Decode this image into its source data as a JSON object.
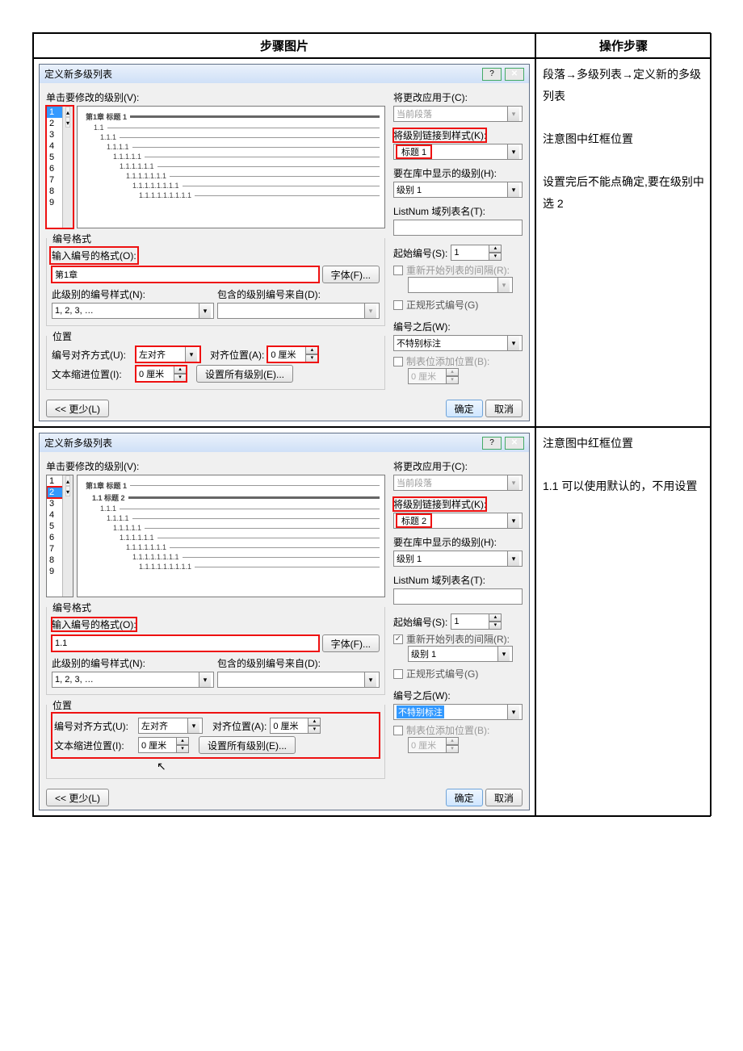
{
  "headers": {
    "left": "步骤图片",
    "right": "操作步骤"
  },
  "step1_text": [
    "段落→多级列表→定义新的多级列表",
    "",
    "注意图中红框位置",
    "",
    "设置完后不能点确定,要在级别中选 2"
  ],
  "step2_text": [
    "注意图中红框位置",
    "",
    "1.1 可以使用默认的，不用设置"
  ],
  "d1": {
    "title": "定义新多级列表",
    "click_label": "单击要修改的级别(V):",
    "levels": [
      "1",
      "2",
      "3",
      "4",
      "5",
      "6",
      "7",
      "8",
      "9"
    ],
    "sel_level": "1",
    "preview_top": "第1章 标题 1",
    "preview_items": [
      "1.1",
      "1.1.1",
      "1.1.1.1",
      "1.1.1.1.1",
      "1.1.1.1.1.1",
      "1.1.1.1.1.1.1",
      "1.1.1.1.1.1.1.1",
      "1.1.1.1.1.1.1.1.1"
    ],
    "numfmt_group": "编号格式",
    "numfmt_label": "输入编号的格式(O):",
    "numfmt_value": "第1章",
    "font_btn": "字体(F)...",
    "numstyle_label": "此级别的编号样式(N):",
    "numstyle_value": "1, 2, 3, …",
    "include_label": "包含的级别编号来自(D):",
    "include_value": "",
    "pos_group": "位置",
    "align_label": "编号对齐方式(U):",
    "align_value": "左对齐",
    "alignpos_label": "对齐位置(A):",
    "alignpos_value": "0 厘米",
    "indent_label": "文本缩进位置(I):",
    "indent_value": "0 厘米",
    "setall_btn": "设置所有级别(E)...",
    "apply_label": "将更改应用于(C):",
    "apply_value": "当前段落",
    "link_label": "将级别链接到样式(K):",
    "link_value": "标题 1",
    "show_label": "要在库中显示的级别(H):",
    "show_value": "级别 1",
    "listnum_label": "ListNum 域列表名(T):",
    "listnum_value": "",
    "start_label": "起始编号(S):",
    "start_value": "1",
    "restart_label": "重新开始列表的间隔(R):",
    "restart_chk": false,
    "restart_value": "",
    "legal_label": "正规形式编号(G)",
    "after_label": "编号之后(W):",
    "after_value": "不特别标注",
    "tab_label": "制表位添加位置(B):",
    "tab_value": "0 厘米",
    "less_btn": "<< 更少(L)",
    "ok_btn": "确定",
    "cancel_btn": "取消"
  },
  "d2": {
    "title": "定义新多级列表",
    "click_label": "单击要修改的级别(V):",
    "levels": [
      "1",
      "2",
      "3",
      "4",
      "5",
      "6",
      "7",
      "8",
      "9"
    ],
    "sel_level": "2",
    "preview_top1": "第1章 标题 1",
    "preview_top2": "1.1 标题 2",
    "preview_items": [
      "1.1.1",
      "1.1.1.1",
      "1.1.1.1.1",
      "1.1.1.1.1.1",
      "1.1.1.1.1.1.1",
      "1.1.1.1.1.1.1.1",
      "1.1.1.1.1.1.1.1.1"
    ],
    "numfmt_group": "编号格式",
    "numfmt_label": "输入编号的格式(O):",
    "numfmt_value": "1.1",
    "font_btn": "字体(F)...",
    "numstyle_label": "此级别的编号样式(N):",
    "numstyle_value": "1, 2, 3, …",
    "include_label": "包含的级别编号来自(D):",
    "include_value": "",
    "pos_group": "位置",
    "align_label": "编号对齐方式(U):",
    "align_value": "左对齐",
    "alignpos_label": "对齐位置(A):",
    "alignpos_value": "0 厘米",
    "indent_label": "文本缩进位置(I):",
    "indent_value": "0 厘米",
    "setall_btn": "设置所有级别(E)...",
    "apply_label": "将更改应用于(C):",
    "apply_value": "当前段落",
    "link_label": "将级别链接到样式(K):",
    "link_value": "标题 2",
    "show_label": "要在库中显示的级别(H):",
    "show_value": "级别 1",
    "listnum_label": "ListNum 域列表名(T):",
    "listnum_value": "",
    "start_label": "起始编号(S):",
    "start_value": "1",
    "restart_label": "重新开始列表的间隔(R):",
    "restart_chk": true,
    "restart_value": "级别 1",
    "legal_label": "正规形式编号(G)",
    "after_label": "编号之后(W):",
    "after_value": "不特别标注",
    "tab_label": "制表位添加位置(B):",
    "tab_value": "0 厘米",
    "less_btn": "<< 更少(L)",
    "ok_btn": "确定",
    "cancel_btn": "取消"
  }
}
